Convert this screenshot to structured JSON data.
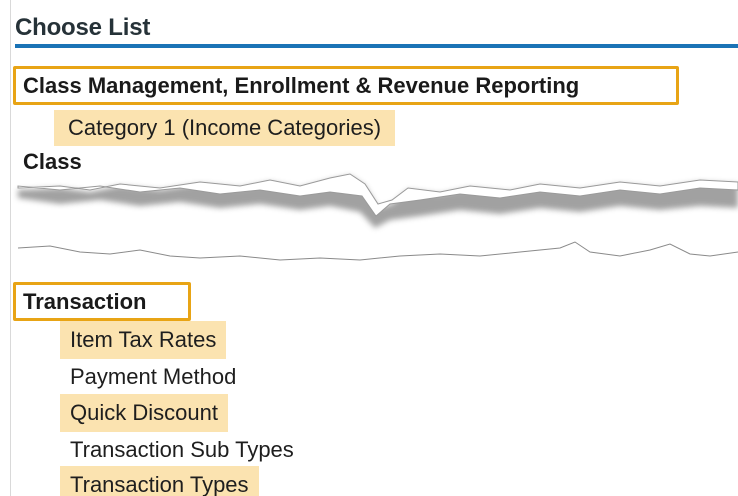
{
  "panel": {
    "title": "Choose List"
  },
  "groups": [
    {
      "label": "Class Management, Enrollment & Revenue Reporting",
      "items": [
        "Category 1 (Income Categories)"
      ]
    },
    {
      "label": "Class",
      "items": []
    },
    {
      "label": "Transaction",
      "items": [
        "Item Tax Rates",
        "Payment Method",
        "Quick Discount",
        "Transaction Sub Types",
        "Transaction Types"
      ]
    }
  ],
  "colors": {
    "accent_underline": "#1a73b6",
    "highlight_fill": "#fbe3b0",
    "highlight_outline": "#e8a415"
  }
}
